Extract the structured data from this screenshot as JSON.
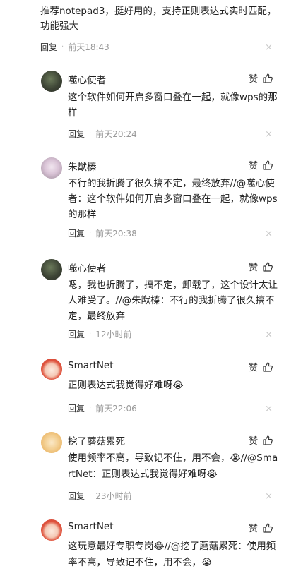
{
  "top": {
    "text": "推荐notepad3，挺好用的，支持正则表达式实时匹配，功能强大",
    "reply": "回复",
    "dot": "·",
    "time": "前天18:43",
    "close": "×"
  },
  "comments": [
    {
      "user": "噬心使者",
      "like": "赞",
      "text": "这个软件如何开启多窗口叠在一起，就像wps的那样",
      "reply": "回复",
      "dot": "·",
      "time": "前天20:24",
      "close": "×"
    },
    {
      "user": "朱猷榛",
      "like": "赞",
      "text": "不行的我折腾了很久搞不定，最终放弃//@噬心使者：这个软件如何开启多窗口叠在一起，就像wps的那样",
      "reply": "回复",
      "dot": "·",
      "time": "前天20:38",
      "close": "×"
    },
    {
      "user": "噬心使者",
      "like": "赞",
      "text": "嗯，我也折腾了，搞不定，卸载了，这个设计太让人难受了。//@朱猷榛：不行的我折腾了很久搞不定，最终放弃",
      "reply": "回复",
      "dot": "·",
      "time": "12小时前",
      "close": "×"
    },
    {
      "user": "SmartNet",
      "like": "赞",
      "text": "正则表达式我觉得好难呀",
      "emoji": "😭",
      "reply": "回复",
      "dot": "·",
      "time": "前天22:06",
      "close": "×"
    },
    {
      "user": "挖了蘑菇累死",
      "like": "赞",
      "text1": "使用频率不高，导致记不住，用不会，",
      "text2": "//@SmartNet：正则表达式我觉得好难呀",
      "emoji": "😭",
      "reply": "回复",
      "dot": "·",
      "time": "23小时前",
      "close": "×"
    },
    {
      "user": "SmartNet",
      "like": "赞",
      "text1": "这玩意最好专职专岗",
      "text2": "//@挖了蘑菇累死：使用频率不高，导致记不住，用不会，",
      "emoji1": "😂",
      "emoji2": "😭"
    }
  ],
  "colors": {
    "meta_time": "#999999",
    "close": "#c8c8c8",
    "text": "#222222"
  }
}
